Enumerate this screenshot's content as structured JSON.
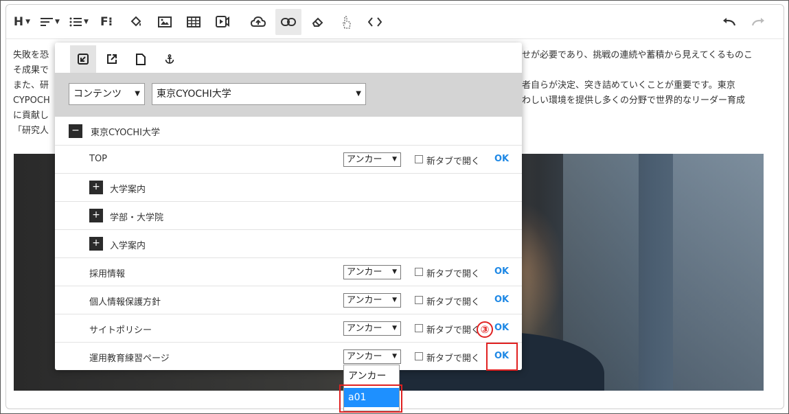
{
  "toolbar": {
    "heading_label": "H",
    "format_label": "F⁝"
  },
  "content": {
    "lines": [
      "失敗を恐",
      "そ成果で",
      "また、研",
      "CYPOCH",
      "に貢献し",
      "「研究人"
    ],
    "right_lines": [
      "せが必要であり、挑戦の連続や蓄積から見えてくるものこ",
      "",
      "者自らが決定、突き詰めていくことが重要です。東京",
      "わしい環境を提供し多くの分野で世界的なリーダー育成"
    ]
  },
  "popup": {
    "tabs": [
      "internal-link",
      "external-link",
      "file-link",
      "anchor"
    ],
    "type_select": "コンテンツ",
    "site_select": "東京CYOCHI大学",
    "root": {
      "toggle": "−",
      "label": "東京CYOCHI大学"
    },
    "rows": [
      {
        "label": "TOP",
        "anchor": "アンカー",
        "newtab": "新タブで開く",
        "ok": "OK"
      },
      {
        "toggle": "+",
        "label": "大学案内"
      },
      {
        "toggle": "+",
        "label": "学部・大学院"
      },
      {
        "toggle": "+",
        "label": "入学案内"
      },
      {
        "label": "採用情報",
        "anchor": "アンカー",
        "newtab": "新タブで開く",
        "ok": "OK"
      },
      {
        "label": "個人情報保護方針",
        "anchor": "アンカー",
        "newtab": "新タブで開く",
        "ok": "OK"
      },
      {
        "label": "サイトポリシー",
        "anchor": "アンカー",
        "newtab": "新タブで開く",
        "ok": "OK"
      },
      {
        "label": "運用教育練習ページ",
        "anchor": "アンカー",
        "newtab": "新タブで開く",
        "ok": "OK"
      }
    ]
  },
  "dropdown": {
    "options": [
      "アンカー",
      "a01"
    ],
    "selected": "a01"
  },
  "annotation": {
    "step": "③"
  },
  "colors": {
    "ok_link": "#1e88e5",
    "highlight": "#e02020",
    "selected_option": "#1e90ff"
  }
}
